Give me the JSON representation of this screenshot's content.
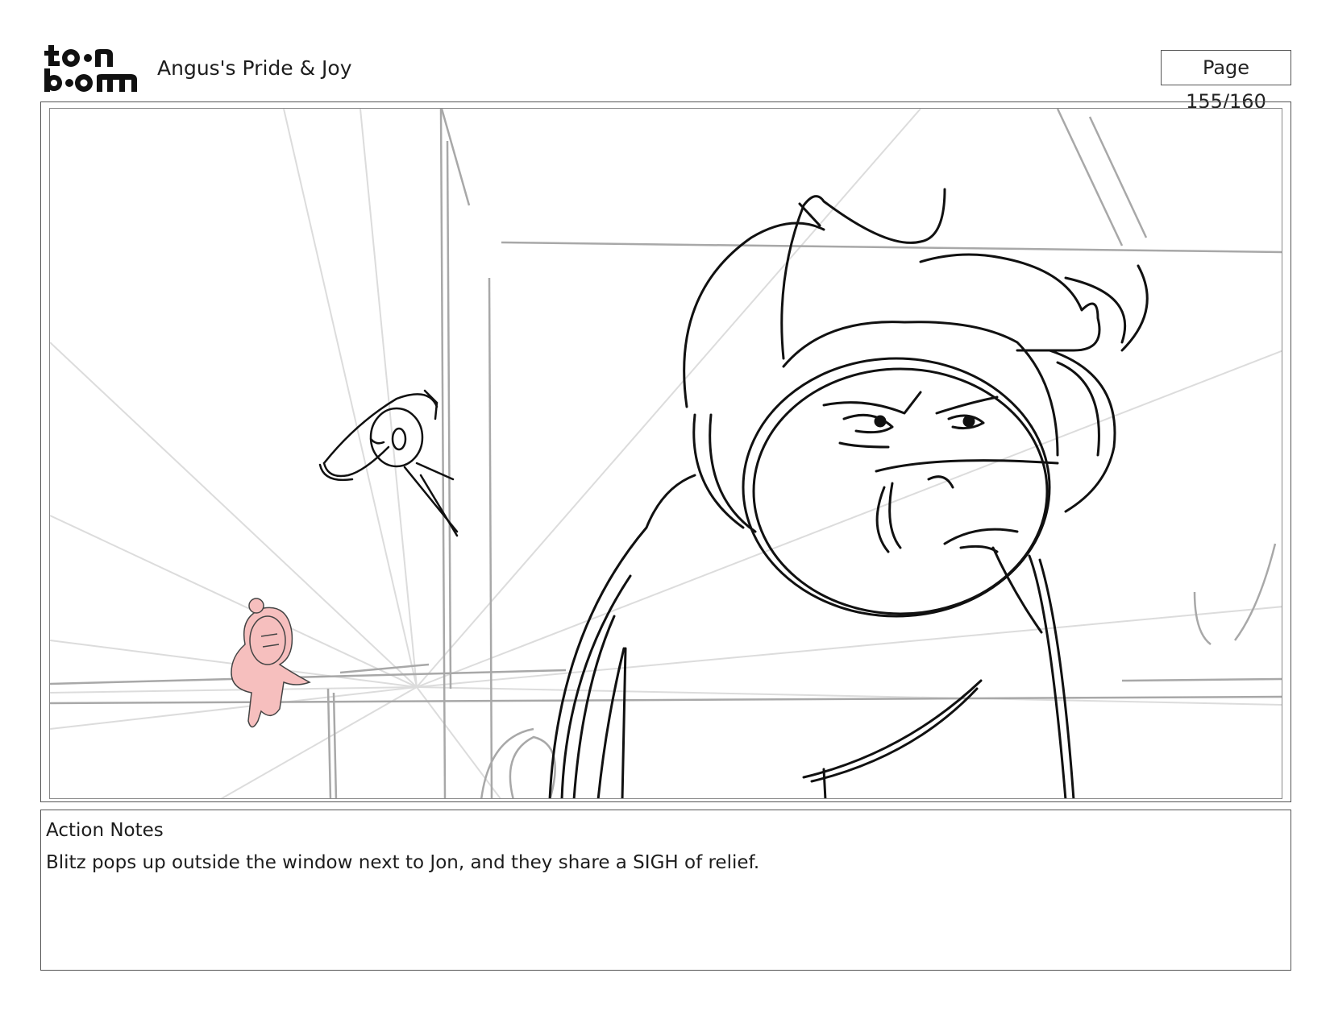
{
  "header": {
    "logo_text": "toon boom",
    "project_title": "Angus's Pride & Joy",
    "page_label": "Page 155/160"
  },
  "panel": {
    "image_description": ""
  },
  "notes": {
    "label": "Action Notes",
    "text": "Blitz pops up outside the window next to Jon, and they share a SIGH of relief."
  }
}
